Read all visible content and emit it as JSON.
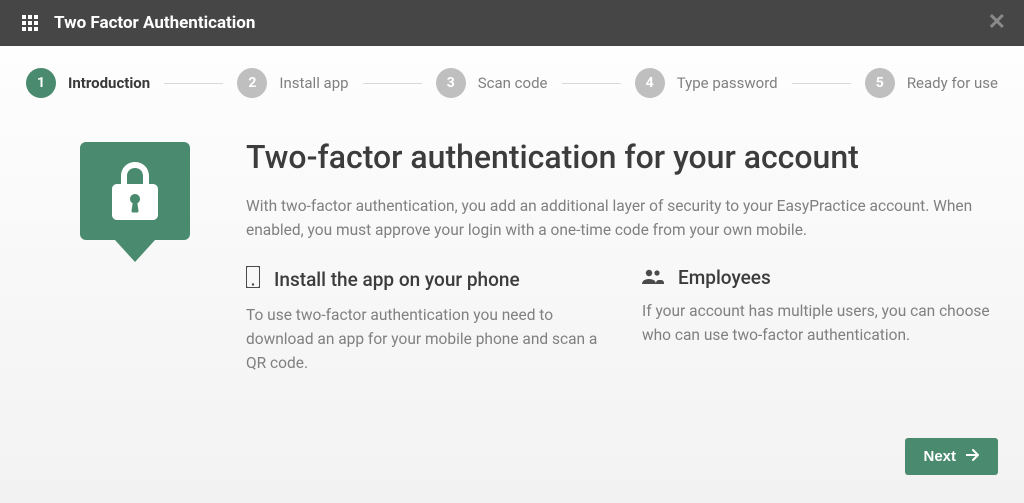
{
  "header": {
    "title": "Two Factor Authentication"
  },
  "steps": [
    {
      "num": "1",
      "label": "Introduction",
      "active": true
    },
    {
      "num": "2",
      "label": "Install app",
      "active": false
    },
    {
      "num": "3",
      "label": "Scan code",
      "active": false
    },
    {
      "num": "4",
      "label": "Type password",
      "active": false
    },
    {
      "num": "5",
      "label": "Ready for use",
      "active": false
    }
  ],
  "main": {
    "heading": "Two-factor authentication for your account",
    "lead": "With two-factor authentication, you add an additional layer of security to your EasyPractice account. When enabled, you must approve your login with a one-time code from your own mobile.",
    "install": {
      "title": "Install the app on your phone",
      "body": "To use two-factor authentication you need to download an app for your mobile phone and scan a QR code."
    },
    "employees": {
      "title": "Employees",
      "body": "If your account has multiple users, you can choose who can use two-factor authentication."
    }
  },
  "footer": {
    "next": "Next"
  }
}
